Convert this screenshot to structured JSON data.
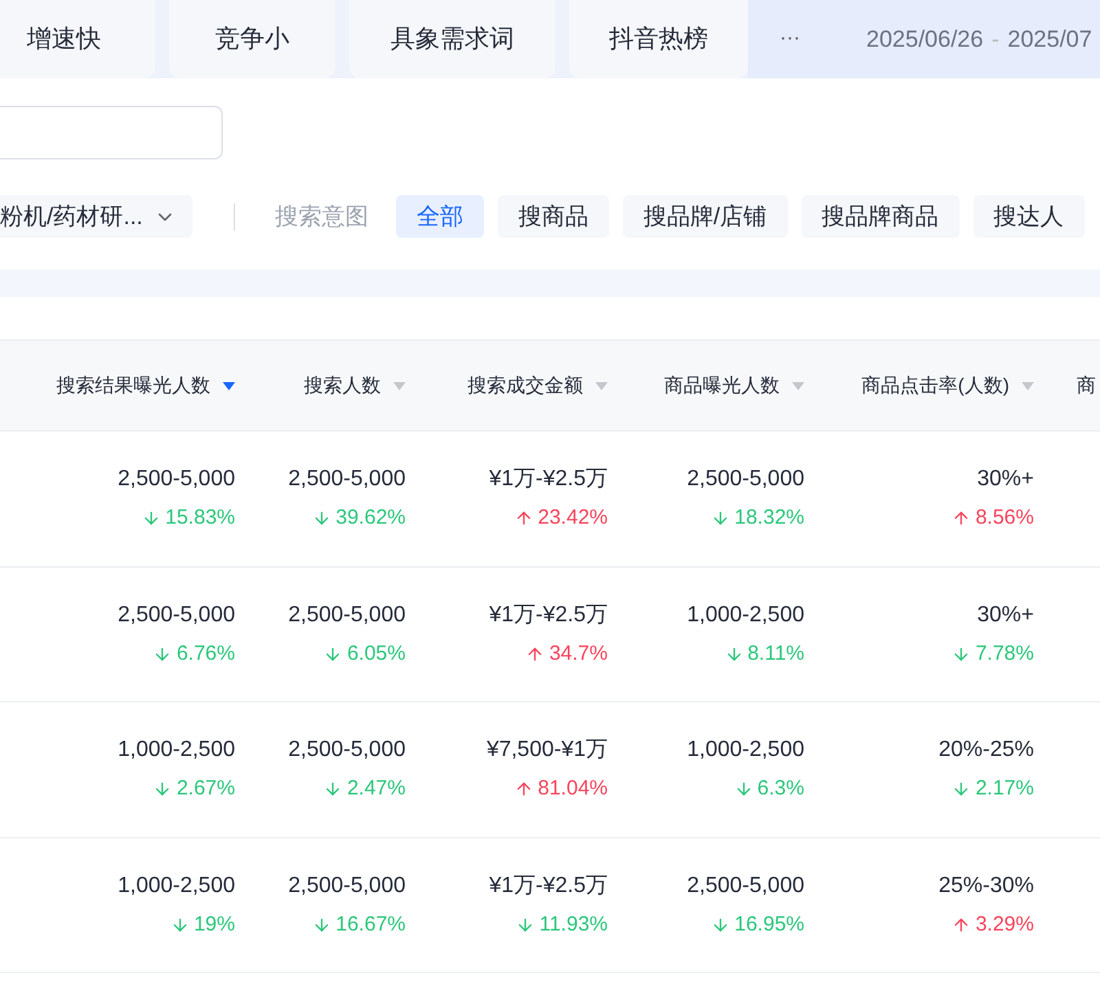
{
  "tabs": [
    {
      "label": "增速快",
      "selected": false
    },
    {
      "label": "竞争小",
      "selected": false
    },
    {
      "label": "具象需求词",
      "selected": false
    },
    {
      "label": "抖音热榜",
      "selected": false
    }
  ],
  "more_label": "···",
  "date_range": {
    "start": "2025/06/26",
    "separator": "-",
    "end": "2025/07"
  },
  "category_dropdown": {
    "value": "粉机/药材研..."
  },
  "intent_filter": {
    "label": "搜索意图",
    "chips": [
      {
        "label": "全部",
        "selected": true
      },
      {
        "label": "搜商品",
        "selected": false
      },
      {
        "label": "搜品牌/店铺",
        "selected": false
      },
      {
        "label": "搜品牌商品",
        "selected": false
      },
      {
        "label": "搜达人",
        "selected": false
      }
    ]
  },
  "table": {
    "columns": [
      {
        "label": "搜索结果曝光人数",
        "sorted": true
      },
      {
        "label": "搜索人数",
        "sorted": false
      },
      {
        "label": "搜索成交金额",
        "sorted": false
      },
      {
        "label": "商品曝光人数",
        "sorted": false
      },
      {
        "label": "商品点击率(人数)",
        "sorted": false
      },
      {
        "label": "商"
      }
    ],
    "rows": [
      {
        "cells": [
          {
            "value": "2,500-5,000",
            "change": "15.83%",
            "kind": "down"
          },
          {
            "value": "2,500-5,000",
            "change": "39.62%",
            "kind": "down"
          },
          {
            "value": "¥1万-¥2.5万",
            "change": "23.42%",
            "kind": "up"
          },
          {
            "value": "2,500-5,000",
            "change": "18.32%",
            "kind": "down"
          },
          {
            "value": "30%+",
            "change": "8.56%",
            "kind": "up"
          }
        ]
      },
      {
        "cells": [
          {
            "value": "2,500-5,000",
            "change": "6.76%",
            "kind": "down"
          },
          {
            "value": "2,500-5,000",
            "change": "6.05%",
            "kind": "down"
          },
          {
            "value": "¥1万-¥2.5万",
            "change": "34.7%",
            "kind": "up"
          },
          {
            "value": "1,000-2,500",
            "change": "8.11%",
            "kind": "down"
          },
          {
            "value": "30%+",
            "change": "7.78%",
            "kind": "down"
          }
        ]
      },
      {
        "cells": [
          {
            "value": "1,000-2,500",
            "change": "2.67%",
            "kind": "down"
          },
          {
            "value": "2,500-5,000",
            "change": "2.47%",
            "kind": "down"
          },
          {
            "value": "¥7,500-¥1万",
            "change": "81.04%",
            "kind": "up"
          },
          {
            "value": "1,000-2,500",
            "change": "6.3%",
            "kind": "down"
          },
          {
            "value": "20%-25%",
            "change": "2.17%",
            "kind": "down"
          }
        ]
      },
      {
        "cells": [
          {
            "value": "1,000-2,500",
            "change": "19%",
            "kind": "down"
          },
          {
            "value": "2,500-5,000",
            "change": "16.67%",
            "kind": "down"
          },
          {
            "value": "¥1万-¥2.5万",
            "change": "11.93%",
            "kind": "down"
          },
          {
            "value": "2,500-5,000",
            "change": "16.95%",
            "kind": "down"
          },
          {
            "value": "25%-30%",
            "change": "3.29%",
            "kind": "up"
          }
        ]
      }
    ]
  }
}
